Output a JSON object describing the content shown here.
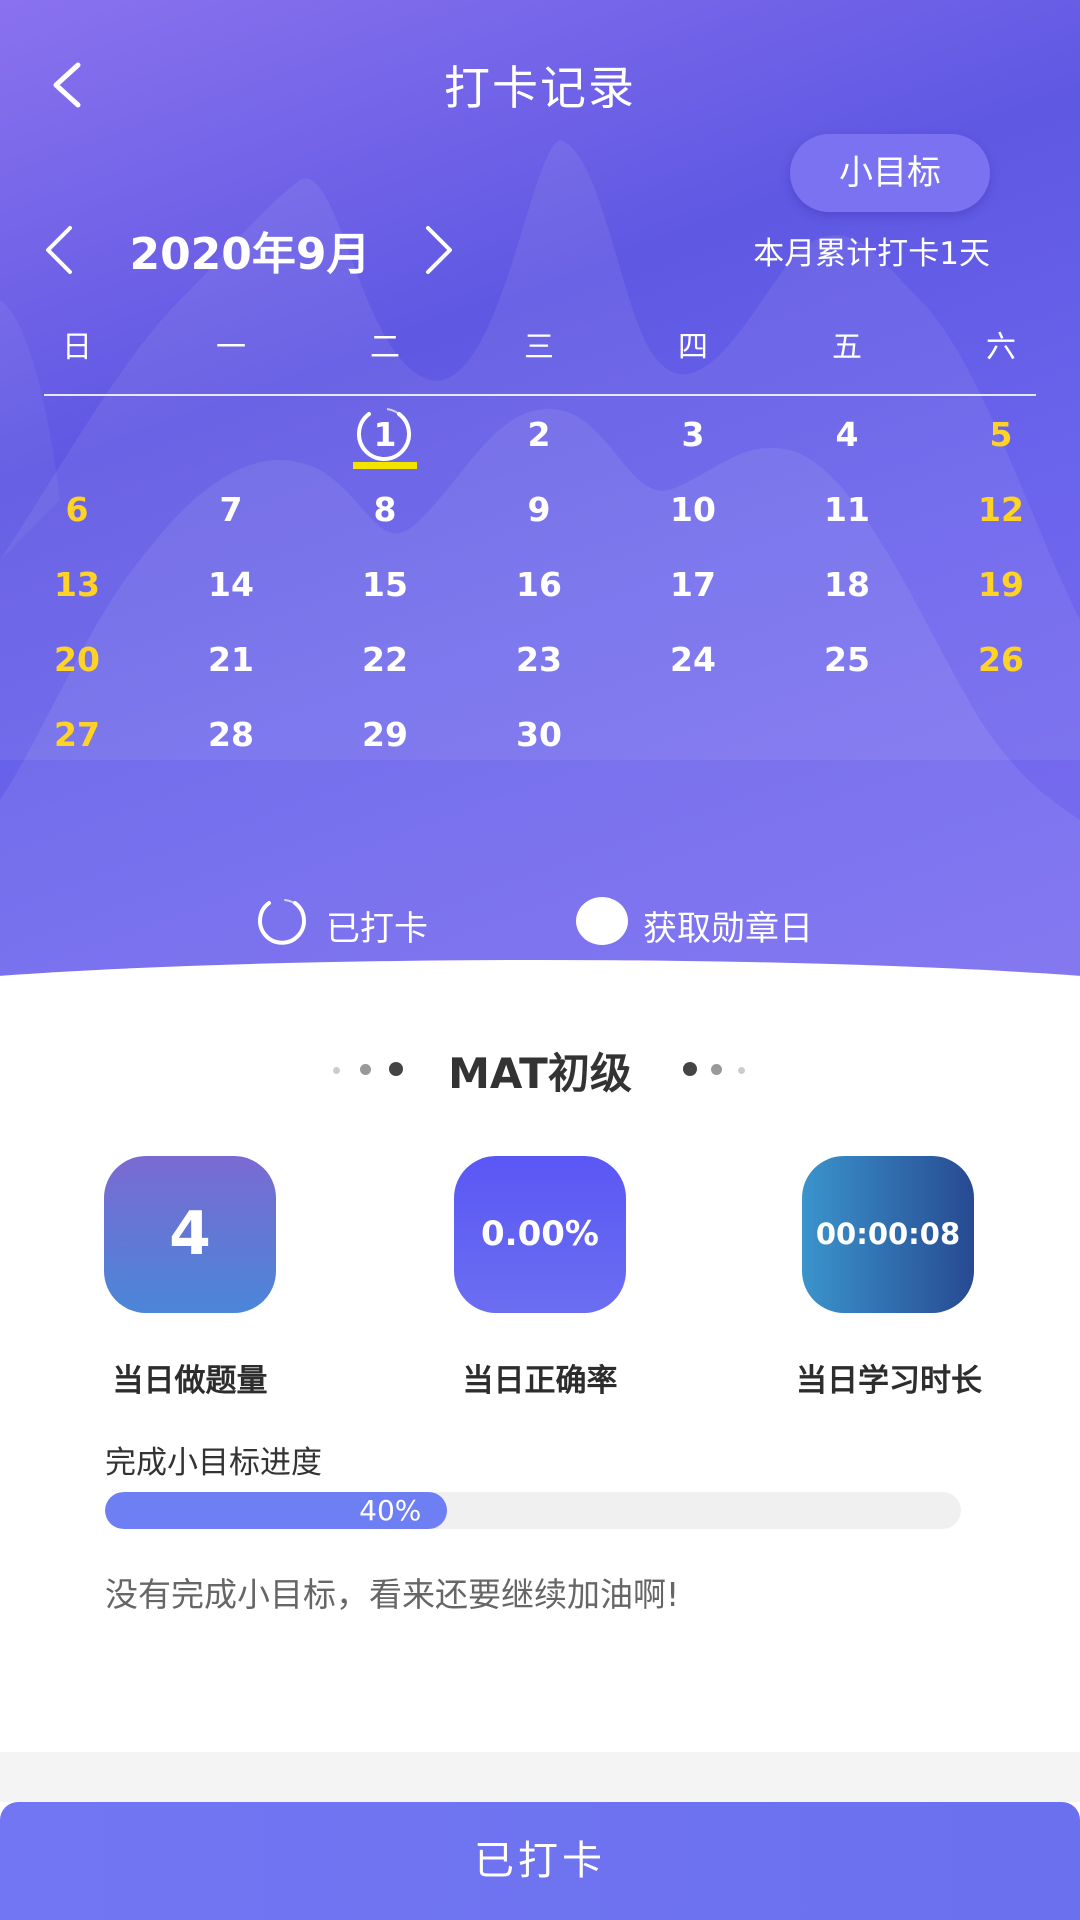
{
  "header": {
    "title": "打卡记录",
    "goal_button": "小目标",
    "month_label": "2020年9月",
    "month_summary": "本月累计打卡1天"
  },
  "calendar": {
    "weekdays": [
      "日",
      "一",
      "二",
      "三",
      "四",
      "五",
      "六"
    ],
    "rows": [
      [
        "",
        "",
        "1",
        "2",
        "3",
        "4",
        "5"
      ],
      [
        "6",
        "7",
        "8",
        "9",
        "10",
        "11",
        "12"
      ],
      [
        "13",
        "14",
        "15",
        "16",
        "17",
        "18",
        "19"
      ],
      [
        "20",
        "21",
        "22",
        "23",
        "24",
        "25",
        "26"
      ],
      [
        "27",
        "28",
        "29",
        "30",
        "",
        "",
        ""
      ]
    ],
    "checked_day": "1",
    "weekend_color": "#ffd326"
  },
  "legend": {
    "checked": "已打卡",
    "medal_day": "获取勋章日"
  },
  "level": {
    "title": "MAT初级"
  },
  "stats": [
    {
      "value": "4",
      "label": "当日做题量"
    },
    {
      "value": "0.00%",
      "label": "当日正确率"
    },
    {
      "value": "00:00:08",
      "label": "当日学习时长"
    }
  ],
  "progress": {
    "title": "完成小目标进度",
    "percent_label": "40%",
    "percent": 0.4,
    "message": "没有完成小目标，看来还要继续加油啊!"
  },
  "footer": {
    "button_label": "已打卡"
  },
  "colors": {
    "accent": "#6a70ee",
    "weekend": "#ffd326",
    "underline": "#f3e400"
  }
}
